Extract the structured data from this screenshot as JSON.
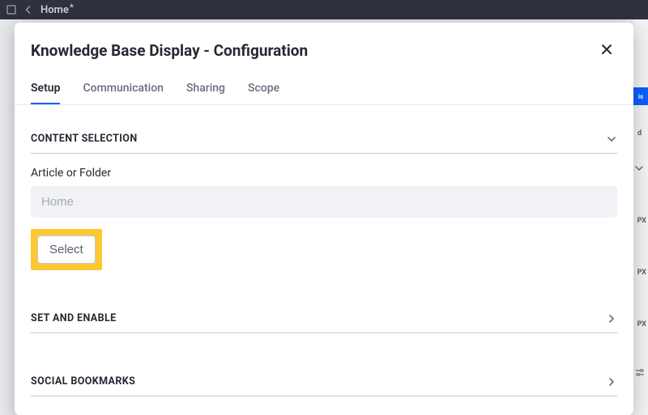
{
  "header": {
    "home_label": "Home",
    "dirty_mark": "*"
  },
  "modal": {
    "title": "Knowledge Base Display - Configuration",
    "tabs": [
      {
        "label": "Setup",
        "active": true
      },
      {
        "label": "Communication"
      },
      {
        "label": "Sharing"
      },
      {
        "label": "Scope"
      }
    ],
    "sections": {
      "content_selection": {
        "title": "CONTENT SELECTION",
        "field_label": "Article or Folder",
        "field_value": "Home",
        "select_button": "Select"
      },
      "set_and_enable": {
        "title": "SET AND ENABLE"
      },
      "social_bookmarks": {
        "title": "SOCIAL BOOKMARKS"
      }
    }
  },
  "right_strip": {
    "blue_text": "is",
    "label_d": "d",
    "px1": "PX",
    "px2": "PX",
    "px3": "PX"
  }
}
